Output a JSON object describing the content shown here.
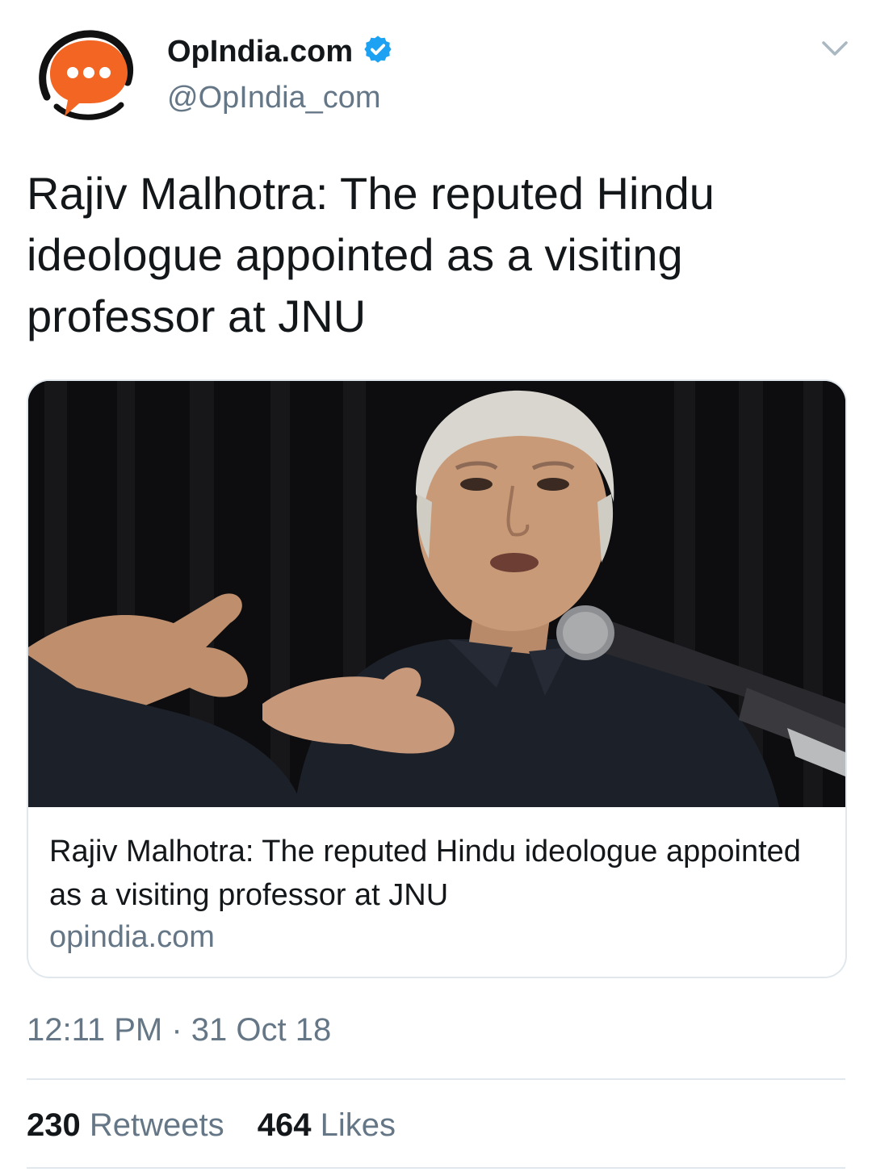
{
  "account": {
    "display_name": "OpIndia.com",
    "handle": "@OpIndia_com",
    "verified": true,
    "avatar_icon": "chat-bubble-logo",
    "brand_color": "#f26522"
  },
  "menu": {
    "icon": "chevron-down-icon"
  },
  "tweet": {
    "text": "Rajiv Malhotra: The reputed Hindu ideologue appointed as a visiting professor at JNU"
  },
  "card": {
    "title": "Rajiv Malhotra: The reputed Hindu ideologue appointed as a visiting professor at JNU",
    "domain": "opindia.com"
  },
  "timestamp": "12:11 PM · 31 Oct 18",
  "stats": {
    "retweets_count": "230",
    "retweets_label": "Retweets",
    "likes_count": "464",
    "likes_label": "Likes"
  },
  "colors": {
    "text_primary": "#14171a",
    "text_secondary": "#657786",
    "verified_blue": "#1da1f2",
    "border": "#e1e8ed"
  }
}
